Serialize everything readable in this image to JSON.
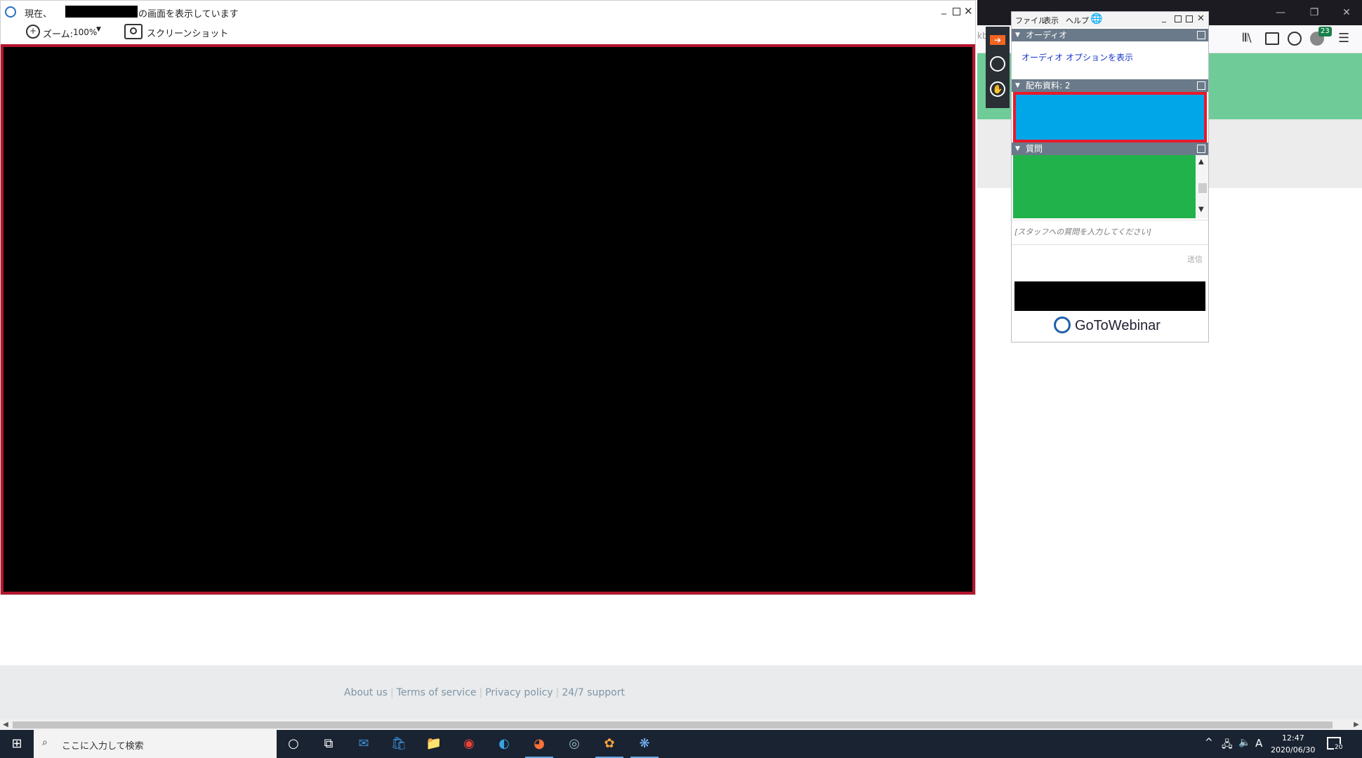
{
  "viewer": {
    "title_prefix": "現在、",
    "title_suffix": "の画面を表示しています",
    "zoom_label": "ズーム:",
    "zoom_value": "100%",
    "screenshot_label": "スクリーンショット"
  },
  "gtw": {
    "menu": {
      "file": "ファイル",
      "view": "表示",
      "help": "ヘルプ"
    },
    "audio_section": "オーディオ",
    "audio_link": "オーディオ オプションを表示",
    "handouts_section": "配布資料: 2",
    "questions_section": "質問",
    "question_placeholder": "[スタッフへの質問を入力してください]",
    "send_label": "送信",
    "brand": "GoToWebinar"
  },
  "browser": {
    "notification_count": "23",
    "footer_links": [
      "About us",
      "Terms of service",
      "Privacy policy",
      "24/7 support"
    ]
  },
  "taskbar": {
    "search_placeholder": "ここに入力して検索",
    "time": "12:47",
    "date": "2020/06/30",
    "ime": "A",
    "notification_count": "20"
  },
  "colors": {
    "handout_fill": "#00a6e8",
    "handout_outline": "#e8192c",
    "questions_fill": "#22b24c",
    "screen_border": "#b3142d",
    "page_green": "#6fcb97"
  }
}
